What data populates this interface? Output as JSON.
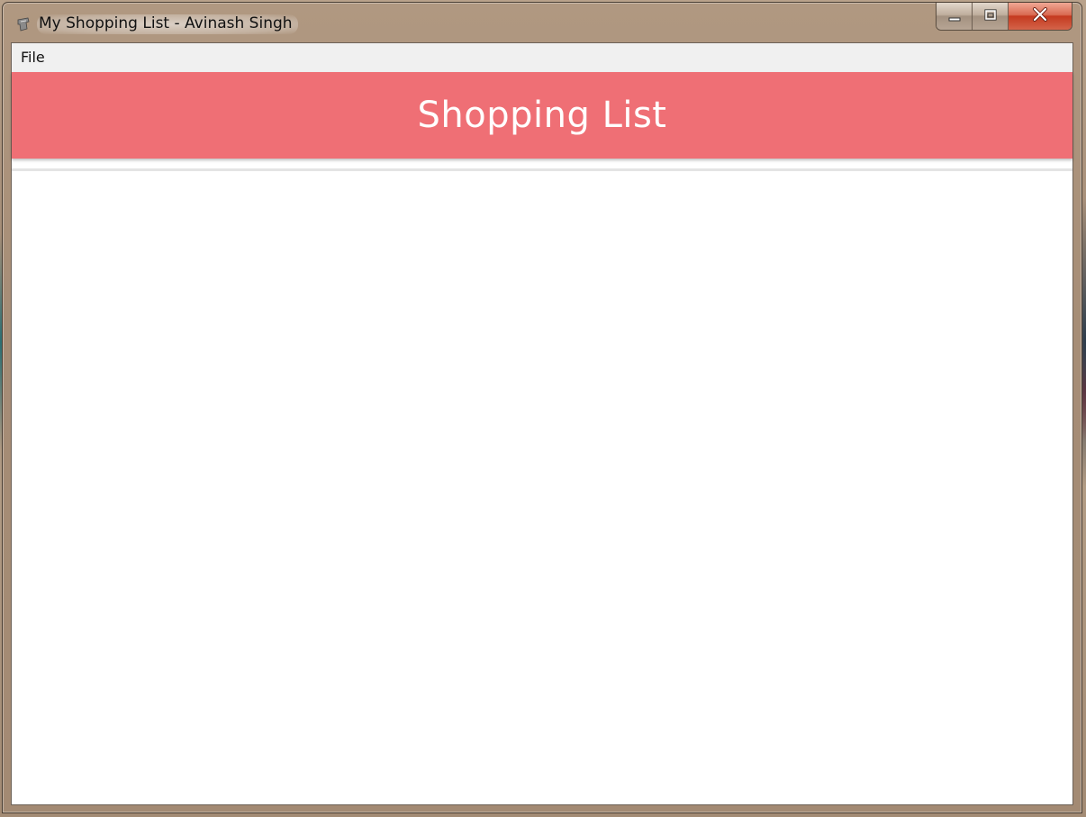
{
  "window": {
    "title": "My Shopping List - Avinash Singh",
    "icon": "app-icon",
    "controls": {
      "minimize_icon": "minimize-icon",
      "maximize_icon": "maximize-icon",
      "close_icon": "close-icon"
    }
  },
  "menubar": {
    "items": [
      {
        "label": "File"
      }
    ]
  },
  "header": {
    "title": "Shopping List",
    "background_color": "#ef6f75",
    "text_color": "#ffffff"
  },
  "list": {
    "items": []
  }
}
